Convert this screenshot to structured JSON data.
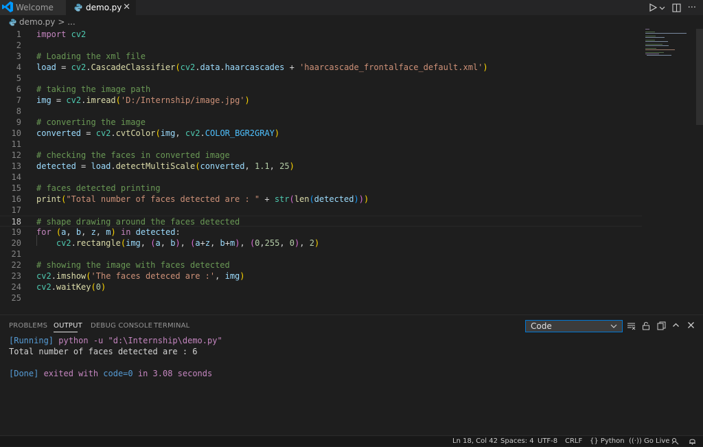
{
  "tabs": [
    {
      "label": "Welcome",
      "active": false
    },
    {
      "label": "demo.py",
      "active": true
    }
  ],
  "breadcrumb": {
    "file": "demo.py",
    "more": "> ..."
  },
  "editor": {
    "active_line": 18,
    "lines": [
      {
        "n": "1",
        "text": "import cv2"
      },
      {
        "n": "2",
        "text": ""
      },
      {
        "n": "3",
        "text": "# Loading the xml file"
      },
      {
        "n": "4",
        "text": "load = cv2.CascadeClassifier(cv2.data.haarcascades + 'haarcascade_frontalface_default.xml')"
      },
      {
        "n": "5",
        "text": ""
      },
      {
        "n": "6",
        "text": "# taking the image path"
      },
      {
        "n": "7",
        "text": "img = cv2.imread('D:/Internship/image.jpg')"
      },
      {
        "n": "8",
        "text": ""
      },
      {
        "n": "9",
        "text": "# converting the image"
      },
      {
        "n": "10",
        "text": "converted = cv2.cvtColor(img, cv2.COLOR_BGR2GRAY)"
      },
      {
        "n": "11",
        "text": ""
      },
      {
        "n": "12",
        "text": "# checking the faces in converted image"
      },
      {
        "n": "13",
        "text": "detected = load.detectMultiScale(converted, 1.1, 25)"
      },
      {
        "n": "14",
        "text": ""
      },
      {
        "n": "15",
        "text": "# faces detected printing"
      },
      {
        "n": "16",
        "text": "print(\"Total number of faces detected are : \" + str(len(detected)))"
      },
      {
        "n": "17",
        "text": ""
      },
      {
        "n": "18",
        "text": "# shape drawing around the faces detected"
      },
      {
        "n": "19",
        "text": "for (a, b, z, m) in detected:"
      },
      {
        "n": "20",
        "text": "    cv2.rectangle(img, (a, b), (a+z, b+m), (0,255, 0), 2)"
      },
      {
        "n": "21",
        "text": ""
      },
      {
        "n": "22",
        "text": "# showing the image with faces detected"
      },
      {
        "n": "23",
        "text": "cv2.imshow('The faces deteced are :', img)"
      },
      {
        "n": "24",
        "text": "cv2.waitKey(0)"
      },
      {
        "n": "25",
        "text": ""
      }
    ]
  },
  "panel": {
    "tabs": [
      "PROBLEMS",
      "OUTPUT",
      "DEBUG CONSOLE",
      "TERMINAL"
    ],
    "active_tab": "OUTPUT",
    "channel": "Code",
    "output": {
      "running_tag": "[Running]",
      "running_cmd": " python -u \"d:\\Internship\\demo.py\"",
      "result": "Total number of faces detected are : 6",
      "done_tag": "[Done]",
      "done_msg_1": " exited with ",
      "done_code": "code=0",
      "done_msg_2": " in 3.08 seconds"
    }
  },
  "statusbar": {
    "position": "Ln 18, Col 42",
    "spaces": "Spaces: 4",
    "encoding": "UTF-8",
    "eol": "CRLF",
    "language": "Python",
    "golive": "Go Live"
  },
  "colors": {
    "keyword": "#c586c0",
    "variable": "#9cdcfe",
    "function": "#dcdcaa",
    "comment": "#6a9955",
    "string": "#ce9178",
    "number": "#b5cea8",
    "accent": "#0078d4"
  }
}
